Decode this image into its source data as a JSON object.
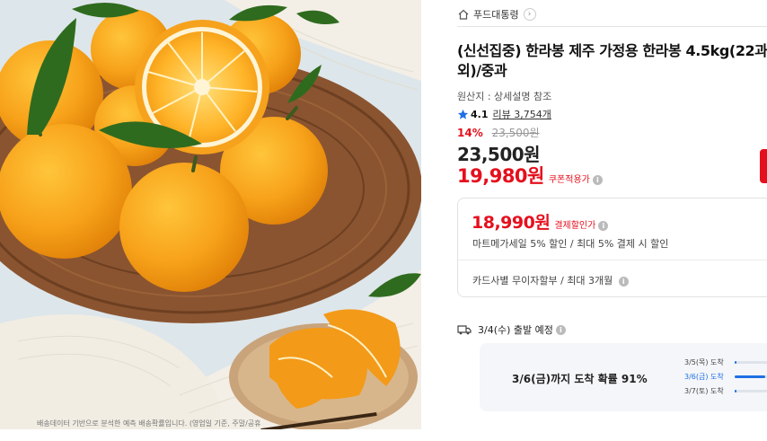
{
  "store": {
    "name": "푸드대통령",
    "home_icon": "home-icon",
    "arrow_icon": "chevron-right-icon"
  },
  "product": {
    "title_line1": "(신선집중) 한라봉 제주 가정용 한라봉 4.5kg(22과",
    "title_line2": "외)/중과",
    "origin": "원산지 : 상세설명 참조",
    "rating": "4.1",
    "review_text": "리뷰 3,754개",
    "discount_rate": "14%",
    "original_price": "23,500원",
    "sale_price": "23,500원",
    "coupon_price": "19,980원",
    "coupon_label": "쿠폰적용가"
  },
  "benefits": {
    "pay_price": "18,990원",
    "pay_label": "결제할인가",
    "pay_detail": "마트메가세일 5% 할인 / 최대 5% 결제 시 할인",
    "card_text": "카드사별 무이자할부 / 최대 3개월"
  },
  "shipping": {
    "departure": "3/4(수) 출발 예정",
    "probability_text": "3/6(금)까지 도착 확률 91%",
    "distribution": [
      {
        "label": "3/5(목) 도착",
        "fraction": 0.05
      },
      {
        "label": "3/6(금) 도착",
        "fraction": 0.86
      },
      {
        "label": "3/7(토) 도착",
        "fraction": 0.06
      }
    ],
    "note": "배송데이터 기반으로 분석한 예측 배송확률입니다. (영업일 기준, 주말/공휴"
  },
  "colors": {
    "accent": "#e5101d",
    "blue": "#1f6fe5",
    "star": "#1f6fe5"
  }
}
